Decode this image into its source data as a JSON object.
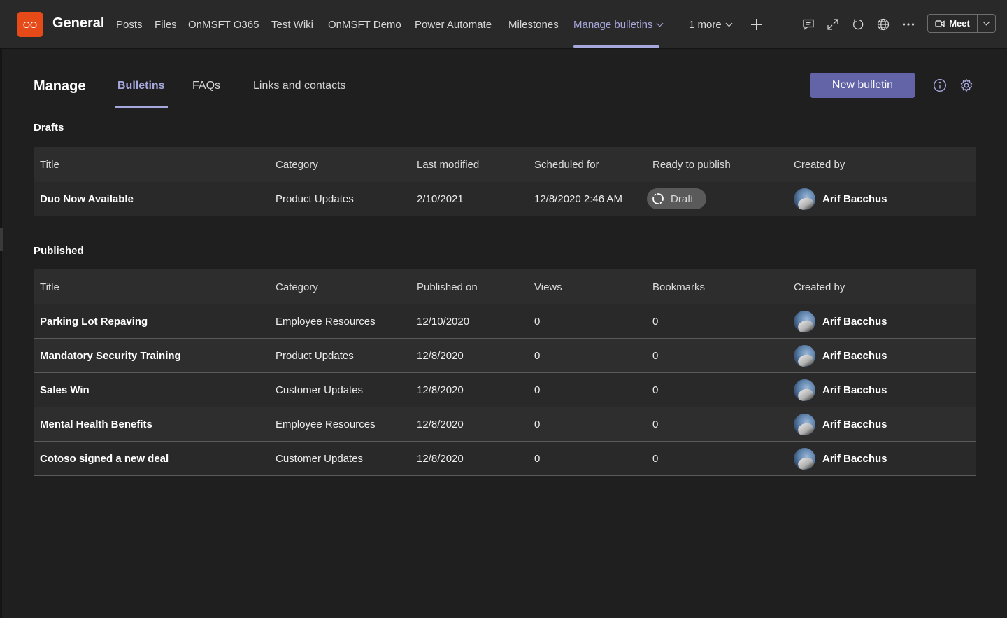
{
  "team": {
    "logo_text": "OO",
    "channel_name": "General"
  },
  "tabs": [
    {
      "label": "Posts"
    },
    {
      "label": "Files"
    },
    {
      "label": "OnMSFT O365"
    },
    {
      "label": "Test Wiki"
    },
    {
      "label": "OnMSFT Demo"
    },
    {
      "label": "Power Automate"
    },
    {
      "label": "Milestones"
    },
    {
      "label": "Manage bulletins"
    },
    {
      "label": "1 more"
    }
  ],
  "meet": {
    "label": "Meet"
  },
  "manage": {
    "title": "Manage",
    "subtabs": [
      "Bulletins",
      "FAQs",
      "Links and contacts"
    ],
    "new_button": "New bulletin"
  },
  "drafts": {
    "label": "Drafts",
    "columns": [
      "Title",
      "Category",
      "Last modified",
      "Scheduled for",
      "Ready to publish",
      "Created by"
    ],
    "rows": [
      {
        "title": "Duo Now Available",
        "category": "Product Updates",
        "last_modified": "2/10/2021",
        "scheduled_for": "12/8/2020 2:46 AM",
        "status": "Draft",
        "created_by": "Arif Bacchus"
      }
    ]
  },
  "published": {
    "label": "Published",
    "columns": [
      "Title",
      "Category",
      "Published on",
      "Views",
      "Bookmarks",
      "Created by"
    ],
    "rows": [
      {
        "title": "Parking Lot Repaving",
        "category": "Employee Resources",
        "published_on": "12/10/2020",
        "views": "0",
        "bookmarks": "0",
        "created_by": "Arif Bacchus"
      },
      {
        "title": "Mandatory Security Training",
        "category": "Product Updates",
        "published_on": "12/8/2020",
        "views": "0",
        "bookmarks": "0",
        "created_by": "Arif Bacchus"
      },
      {
        "title": "Sales Win",
        "category": "Customer Updates",
        "published_on": "12/8/2020",
        "views": "0",
        "bookmarks": "0",
        "created_by": "Arif Bacchus"
      },
      {
        "title": "Mental Health Benefits",
        "category": "Employee Resources",
        "published_on": "12/8/2020",
        "views": "0",
        "bookmarks": "0",
        "created_by": "Arif Bacchus"
      },
      {
        "title": "Cotoso signed a new deal",
        "category": "Customer Updates",
        "published_on": "12/8/2020",
        "views": "0",
        "bookmarks": "0",
        "created_by": "Arif Bacchus"
      }
    ]
  },
  "colors": {
    "background": "#1f1f1f",
    "accent": "#a6a7dc",
    "button": "#6264a7",
    "team_logo": "#e64a19"
  }
}
